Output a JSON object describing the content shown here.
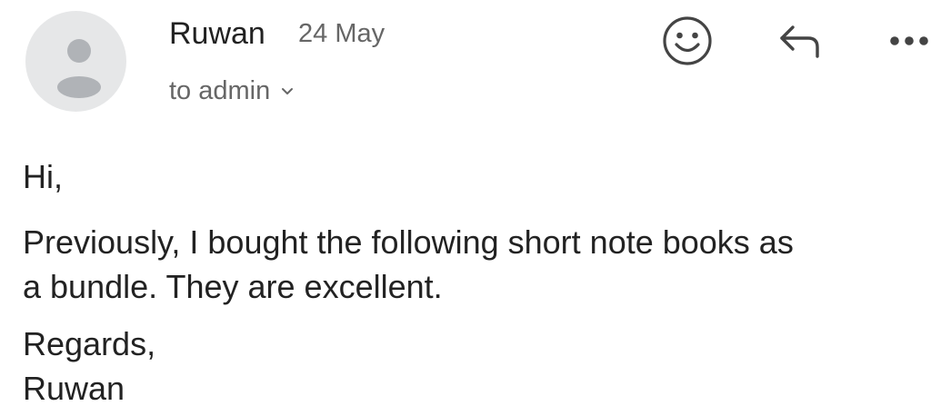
{
  "email": {
    "sender": "Ruwan",
    "date": "24 May",
    "recipient_line": "to admin",
    "body": {
      "greeting": "Hi,",
      "line1": "Previously, I bought the following short note books as",
      "line2": "a bundle. They are excellent.",
      "signoff": "Regards,",
      "signature": "Ruwan"
    }
  },
  "actions": {
    "icons": [
      "add-reaction-icon",
      "reply-icon",
      "more-options-icon"
    ]
  },
  "colors": {
    "avatar_bg": "#e6e7e8",
    "avatar_fg": "#b0b3b7",
    "primary_text": "#222222",
    "secondary_text": "#666666",
    "icon": "#444444"
  }
}
